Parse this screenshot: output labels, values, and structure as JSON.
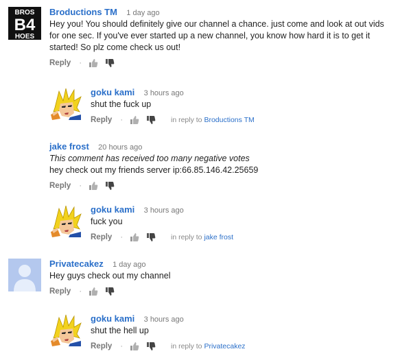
{
  "comments": [
    {
      "author": "Broductions TM",
      "time": "1 day ago",
      "avatar": {
        "type": "logo",
        "lines": [
          "BROS",
          "B4",
          "HOES"
        ]
      },
      "lines": [
        "Hey you! You should definitely give our channel a chance. just come and look at out vids",
        "for one sec. If you've ever started up a new channel, you know how hard it is to get it",
        "started! So plz come check us out!"
      ],
      "reply_label": "Reply"
    },
    {
      "author": "goku kami",
      "time": "3 hours ago",
      "avatar": {
        "type": "cartoon"
      },
      "lines": [
        "shut the fuck up"
      ],
      "reply_label": "Reply",
      "in_reply_prefix": "in reply to",
      "in_reply_to": "Broductions TM"
    },
    {
      "author": "jake frost",
      "time": "20 hours ago",
      "avatar": {
        "type": "none"
      },
      "notice": "This comment has received too many negative votes",
      "lines": [
        "hey check out my friends server ip:66.85.146.42.25659"
      ],
      "reply_label": "Reply"
    },
    {
      "author": "goku kami",
      "time": "3 hours ago",
      "avatar": {
        "type": "cartoon"
      },
      "lines": [
        "fuck you"
      ],
      "reply_label": "Reply",
      "in_reply_prefix": "in reply to",
      "in_reply_to": "jake frost"
    },
    {
      "author": "Privatecakez",
      "time": "1 day ago",
      "avatar": {
        "type": "default"
      },
      "lines": [
        "Hey guys check out my channel"
      ],
      "reply_label": "Reply"
    },
    {
      "author": "goku kami",
      "time": "3 hours ago",
      "avatar": {
        "type": "cartoon"
      },
      "lines": [
        "shut the hell up"
      ],
      "reply_label": "Reply",
      "in_reply_prefix": "in reply to",
      "in_reply_to": "Privatecakez"
    }
  ],
  "actions": {
    "separator": "·"
  },
  "icons": {
    "like": "thumbs-up-icon",
    "dislike": "thumbs-down-icon"
  },
  "colors": {
    "link": "#2a6fc9",
    "muted": "#777777",
    "text": "#222222"
  }
}
